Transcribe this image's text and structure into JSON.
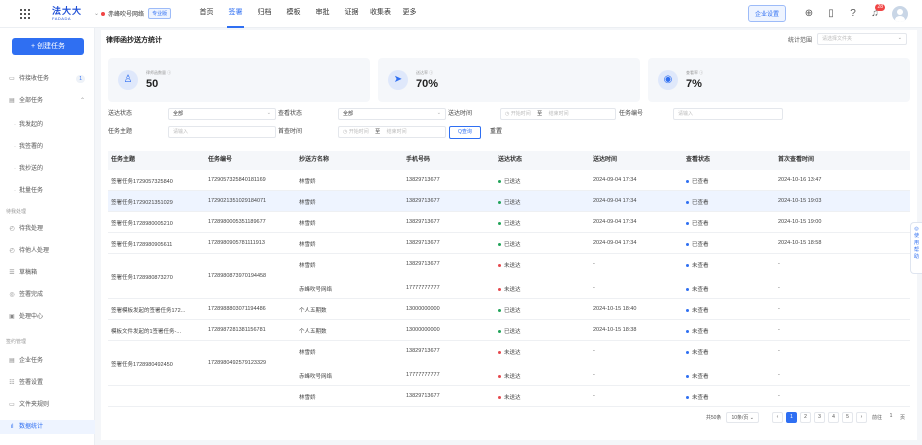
{
  "topbar": {
    "logo_main": "法大大",
    "logo_sub": "FADADA",
    "org_name": "赤峰吹号网络",
    "org_badge": "专业版",
    "nav": [
      "首页",
      "签署",
      "归档",
      "模板",
      "审批",
      "证据",
      "收集表",
      "更多"
    ],
    "active_nav": 1,
    "enterprise_btn": "企业设置",
    "notif_count": "28"
  },
  "sidebar": {
    "create_btn": "+ 创建任务",
    "items": [
      {
        "icon": "inbox-icon",
        "glyph": "▭",
        "label": "待接收任务",
        "count": "1"
      },
      {
        "icon": "all-tasks-icon",
        "glyph": "▤",
        "label": "全部任务",
        "arrow": "⌃"
      }
    ],
    "sub_items": [
      "我发起的",
      "我签署的",
      "我抄送的",
      "批量任务"
    ],
    "group1": "待我处理",
    "group1_items": [
      {
        "icon": "todo-icon",
        "glyph": "◴",
        "label": "待我处理"
      },
      {
        "icon": "others-icon",
        "glyph": "◴",
        "label": "待他人处理"
      },
      {
        "icon": "draft-icon",
        "glyph": "☰",
        "label": "草稿箱"
      },
      {
        "icon": "done-icon",
        "glyph": "◎",
        "label": "签署完成"
      },
      {
        "icon": "manage-icon",
        "glyph": "▣",
        "label": "处理中心"
      }
    ],
    "group2": "签约管理",
    "group2_items": [
      {
        "icon": "enterprise-task-icon",
        "glyph": "▤",
        "label": "企业任务"
      },
      {
        "icon": "sign-settings-icon",
        "glyph": "☷",
        "label": "签署设置"
      },
      {
        "icon": "folder-icon",
        "glyph": "▭",
        "label": "文件夹规则"
      },
      {
        "icon": "stats-icon",
        "glyph": "ıl",
        "label": "数据统计",
        "active": true
      }
    ]
  },
  "main": {
    "title": "律师函抄送方统计",
    "range_label": "统计范围",
    "range_placeholder": "请选择文件夹",
    "stats": [
      {
        "icon": "stamp-icon",
        "glyph": "♙",
        "label": "律师函数量 ⓘ",
        "value": "50"
      },
      {
        "icon": "send-icon",
        "glyph": "➤",
        "label": "送达率 ⓘ",
        "value": "70%"
      },
      {
        "icon": "eye-icon",
        "glyph": "◉",
        "label": "查看率 ⓘ",
        "value": "7%"
      }
    ],
    "filters": {
      "delivery_status_label": "送达状态",
      "delivery_status_value": "全部",
      "view_status_label": "查看状态",
      "view_status_value": "全部",
      "delivery_time_label": "送达时间",
      "start_time": "开始时间",
      "to": "至",
      "end_time": "结束时间",
      "task_no_label": "任务编号",
      "task_no_placeholder": "请输入",
      "task_subject_label": "任务主题",
      "task_subject_placeholder": "请输入",
      "first_view_label": "首查时间",
      "query_btn": "Q查询",
      "reset_btn": "重置"
    },
    "columns": [
      "任务主题",
      "任务编号",
      "抄送方名称",
      "手机号码",
      "送达状态",
      "送达时间",
      "查看状态",
      "首次查看时间"
    ],
    "rows": [
      {
        "subject": "签署任务1729057325840",
        "no": "1729057325840181169",
        "lines": [
          {
            "name": "林雪娇",
            "phone": "13829713677",
            "ds": "已送达",
            "dsc": "green",
            "dt": "2024-09-04 17:34",
            "vs": "已查看",
            "vt": "2024-10-16 13:47"
          }
        ]
      },
      {
        "subject": "签署任务1729021351029",
        "no": "1729021351029184071",
        "hl": true,
        "lines": [
          {
            "name": "林雪娇",
            "phone": "13829713677",
            "ds": "已送达",
            "dsc": "green",
            "dt": "2024-09-04 17:34",
            "vs": "已查看",
            "vt": "2024-10-15 19:03"
          }
        ]
      },
      {
        "subject": "签署任务1728980005210",
        "no": "1728980005351189677",
        "lines": [
          {
            "name": "林雪娇",
            "phone": "13829713677",
            "ds": "已送达",
            "dsc": "green",
            "dt": "2024-09-04 17:34",
            "vs": "已查看",
            "vt": "2024-10-15 19:00"
          }
        ]
      },
      {
        "subject": "签署任务1728980905611",
        "no": "1728980905781111913",
        "lines": [
          {
            "name": "林雪娇",
            "phone": "13829713677",
            "ds": "已送达",
            "dsc": "green",
            "dt": "2024-09-04 17:34",
            "vs": "已查看",
            "vt": "2024-10-15 18:58"
          }
        ]
      },
      {
        "subject": "签署任务1728980873270",
        "no": "1728980873970194458",
        "lines": [
          {
            "name": "林雪娇",
            "phone": "13829713677",
            "ds": "未送达",
            "dsc": "red",
            "dt": "-",
            "vs": "未查看",
            "vt": "-"
          },
          {
            "name": "赤峰吹号网络",
            "phone": "17777777777",
            "ds": "未送达",
            "dsc": "red",
            "dt": "-",
            "vs": "未查看",
            "vt": "-"
          }
        ]
      },
      {
        "subject": "签署模板发起的签署任务172...",
        "no": "1728988803071194486",
        "lines": [
          {
            "name": "个人五期数",
            "phone": "13000000000",
            "ds": "已送达",
            "dsc": "green",
            "dt": "2024-10-15 18:40",
            "vs": "未查看",
            "vt": "-"
          }
        ]
      },
      {
        "subject": "模板文件发起的1签署任务-...",
        "no": "1728987281381156781",
        "lines": [
          {
            "name": "个人五期数",
            "phone": "13000000000",
            "ds": "已送达",
            "dsc": "green",
            "dt": "2024-10-15 18:38",
            "vs": "未查看",
            "vt": "-"
          }
        ]
      },
      {
        "subject": "签署任务1728980492450",
        "no": "1728980492579123329",
        "lines": [
          {
            "name": "林雪娇",
            "phone": "13829713677",
            "ds": "未送达",
            "dsc": "red",
            "dt": "-",
            "vs": "未查看",
            "vt": "-"
          },
          {
            "name": "赤峰吹号网络",
            "phone": "17777777777",
            "ds": "未送达",
            "dsc": "red",
            "dt": "-",
            "vs": "未查看",
            "vt": "-"
          }
        ]
      },
      {
        "subject": "",
        "no": "",
        "lines": [
          {
            "name": "林雪娇",
            "phone": "13829713677",
            "ds": "未送达",
            "dsc": "red",
            "dt": "-",
            "vs": "未查看",
            "vt": "-"
          }
        ]
      }
    ],
    "pager": {
      "total": "共50条",
      "page_size": "10条/页 ⌄",
      "pages": [
        "1",
        "2",
        "3",
        "4",
        "5"
      ],
      "current": "1",
      "goto_label": "前往",
      "goto_value": "1",
      "goto_suffix": "页"
    },
    "help": "使用帮助"
  },
  "colors": {
    "primary": "#2f6ff2",
    "success": "#22a35a",
    "danger": "#e5484d"
  }
}
